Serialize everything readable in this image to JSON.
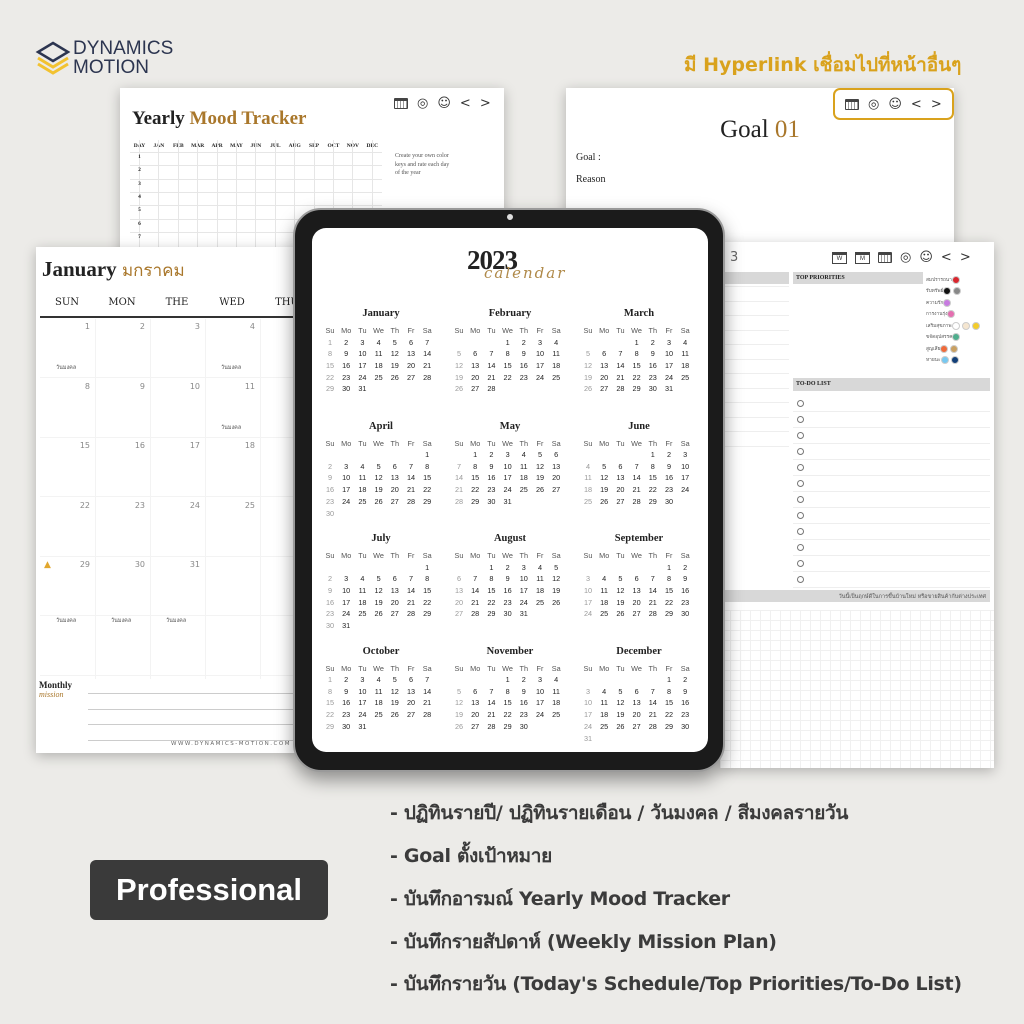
{
  "brand": {
    "line1": "DYNAMICS",
    "line2": "MOTION",
    "colors": {
      "gold": "#f2c230",
      "navy": "#2c3550"
    }
  },
  "hyperlink_heading": "มี Hyperlink เชื่อมไปที่หน้าอื่นๆ",
  "nav_icons": [
    "calendar-icon",
    "target-icon",
    "smiley-icon",
    "chevron-left-icon",
    "chevron-right-icon"
  ],
  "nav_labels": {
    "prev": "<",
    "next": ">",
    "week": "W",
    "month": "M"
  },
  "mood_tracker": {
    "title_a": "Yearly",
    "title_b": "Mood Tracker",
    "headers": [
      "DAY",
      "JAN",
      "FEB",
      "MAR",
      "APR",
      "MAY",
      "JUN",
      "JUL",
      "AUG",
      "SEP",
      "OCT",
      "NOV",
      "DEC"
    ],
    "rows": [
      "1",
      "2",
      "3",
      "4",
      "5",
      "6",
      "7"
    ],
    "note": "Create your own color keys and rate each day of the year"
  },
  "goal": {
    "title_a": "Goal",
    "title_b": "01",
    "goal_label": "Goal :",
    "reason_label": "Reason"
  },
  "january": {
    "title_en": "January",
    "title_th": "มกราคม",
    "weekdays": [
      "SUN",
      "MON",
      "THE",
      "WED",
      "THU"
    ],
    "tag": "วันมงคล",
    "auspicious_days": [
      1,
      4,
      11,
      29,
      30,
      31
    ],
    "monthly_a": "Monthly",
    "monthly_b": "mission",
    "website": "WWW.DYNAMICS-MOTION.COM"
  },
  "tablet_calendar": {
    "year": "2023",
    "script_word": "calendar",
    "months": [
      "January",
      "February",
      "March",
      "April",
      "May",
      "June",
      "July",
      "August",
      "September",
      "October",
      "November",
      "December"
    ],
    "weekdays": [
      "Su",
      "Mo",
      "Tu",
      "We",
      "Th",
      "Fr",
      "Sa"
    ]
  },
  "daily": {
    "date_fragment": "3",
    "top_priorities": "TOP PRIORITIES",
    "todo": "TO-DO LIST",
    "todo_count": 12,
    "legend": [
      {
        "label": "สมปรารถนา",
        "colors": [
          "#d9262e"
        ]
      },
      {
        "label": "รับทรัพย์",
        "colors": [
          "#111111",
          "#888888"
        ]
      },
      {
        "label": "ความรัก",
        "colors": [
          "#c77be0"
        ]
      },
      {
        "label": "การงานรุ่ง",
        "colors": [
          "#e46fb0"
        ]
      },
      {
        "label": "เสริมสุขภาพ",
        "colors": [
          "#ffffff",
          "#f5e6d0",
          "#f3cc2a"
        ]
      },
      {
        "label": "ขจัดอุปสรรค",
        "colors": [
          "#4fae8d"
        ]
      },
      {
        "label": "สูญเสีย",
        "colors": [
          "#ef6a3a",
          "#c9a062"
        ]
      },
      {
        "label": "หายนะ",
        "colors": [
          "#77c8f0",
          "#123f78"
        ]
      }
    ],
    "footer": "วันนี้เป็นฤกษ์ดีในการขึ้นบ้านใหม่ หรือขายสินค้ากับต่างประเทศ"
  },
  "badge": "Professional",
  "features": [
    "- ปฏิทินรายปี/ ปฏิทินรายเดือน / วันมงคล / สีมงคลรายวัน",
    "- Goal ตั้งเป้าหมาย",
    "- บันทึกอารมณ์ Yearly Mood Tracker",
    "- บันทึกรายสัปดาห์ (Weekly Mission Plan)",
    "- บันทึกรายวัน (Today's Schedule/Top Priorities/To-Do List)"
  ]
}
